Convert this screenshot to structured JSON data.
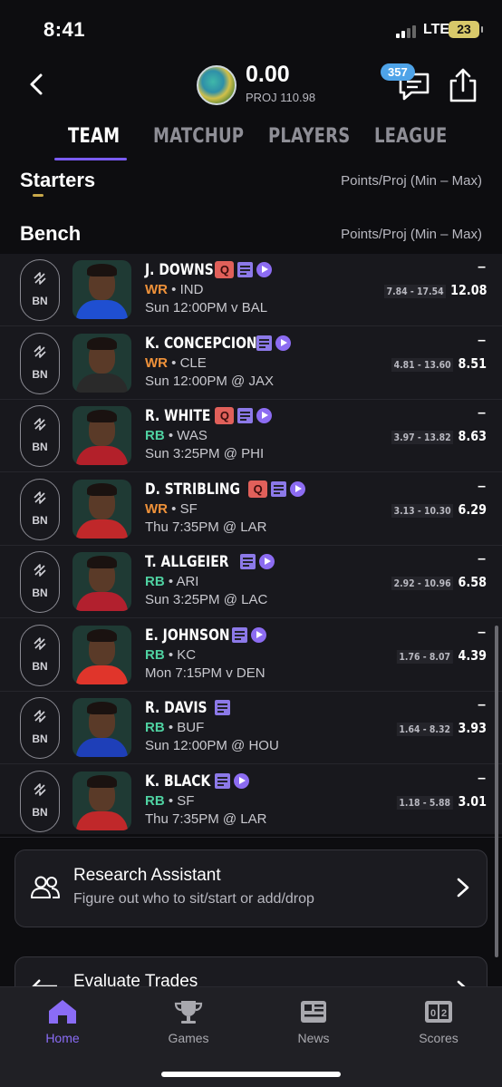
{
  "status": {
    "time": "8:41",
    "network": "LTE",
    "battery": "23"
  },
  "header": {
    "score": "0.00",
    "proj": "PROJ 110.98",
    "chat_badge": "357"
  },
  "tabs": [
    "TEAM",
    "MATCHUP",
    "PLAYERS",
    "LEAGUE"
  ],
  "starters": {
    "title": "Starters",
    "subtitle": "Points/Proj (Min – Max)"
  },
  "bench": {
    "title": "Bench",
    "subtitle": "Points/Proj (Min – Max)"
  },
  "slot_label": "BN",
  "players": [
    {
      "name": "J. DOWNS",
      "pos": "WR",
      "team": "IND",
      "game": "Sun 12:00PM v BAL",
      "badges": [
        "Q",
        "note",
        "play"
      ],
      "points": "–",
      "range": "7.84 - 17.54",
      "proj": "12.08",
      "jersey": "#1f4fd1"
    },
    {
      "name": "K. CONCEPCION",
      "pos": "WR",
      "team": "CLE",
      "game": "Sun 12:00PM @ JAX",
      "badges": [
        "note",
        "play"
      ],
      "points": "–",
      "range": "4.81 - 13.60",
      "proj": "8.51",
      "jersey": "#2a2a2a"
    },
    {
      "name": "R. WHITE",
      "pos": "RB",
      "team": "WAS",
      "game": "Sun 3:25PM @ PHI",
      "badges": [
        "Q",
        "note",
        "play"
      ],
      "points": "–",
      "range": "3.97 - 13.82",
      "proj": "8.63",
      "jersey": "#b3202a"
    },
    {
      "name": "D. STRIBLING",
      "pos": "WR",
      "team": "SF",
      "game": "Thu 7:35PM @ LAR",
      "badges": [
        "Q",
        "note",
        "play"
      ],
      "points": "–",
      "range": "3.13 - 10.30",
      "proj": "6.29",
      "jersey": "#c0282a"
    },
    {
      "name": "T. ALLGEIER",
      "pos": "RB",
      "team": "ARI",
      "game": "Sun 3:25PM @ LAC",
      "badges": [
        "note",
        "play"
      ],
      "points": "–",
      "range": "2.92 - 10.96",
      "proj": "6.58",
      "jersey": "#b2202e"
    },
    {
      "name": "E. JOHNSON",
      "pos": "RB",
      "team": "KC",
      "game": "Mon 7:15PM v DEN",
      "badges": [
        "note",
        "play"
      ],
      "points": "–",
      "range": "1.76 - 8.07",
      "proj": "4.39",
      "jersey": "#e0352b"
    },
    {
      "name": "R. DAVIS",
      "pos": "RB",
      "team": "BUF",
      "game": "Sun 12:00PM @ HOU",
      "badges": [
        "note"
      ],
      "points": "–",
      "range": "1.64 - 8.32",
      "proj": "3.93",
      "jersey": "#1e3fb8"
    },
    {
      "name": "K. BLACK",
      "pos": "RB",
      "team": "SF",
      "game": "Thu 7:35PM @ LAR",
      "badges": [
        "note",
        "play"
      ],
      "points": "–",
      "range": "1.18 - 5.88",
      "proj": "3.01",
      "jersey": "#c0282a"
    }
  ],
  "research": {
    "title": "Research Assistant",
    "subtitle": "Figure out who to sit/start or add/drop"
  },
  "trades": {
    "title": "Evaluate Trades"
  },
  "nav": [
    {
      "label": "Home",
      "icon": "home-icon"
    },
    {
      "label": "Games",
      "icon": "trophy-icon"
    },
    {
      "label": "News",
      "icon": "news-icon"
    },
    {
      "label": "Scores",
      "icon": "scores-icon"
    }
  ],
  "colors": {
    "accent": "#7b5cff",
    "wr": "#f0923a",
    "rb": "#4fd1a1",
    "injury": "#e0605a",
    "badge": "#4ea3e8"
  }
}
